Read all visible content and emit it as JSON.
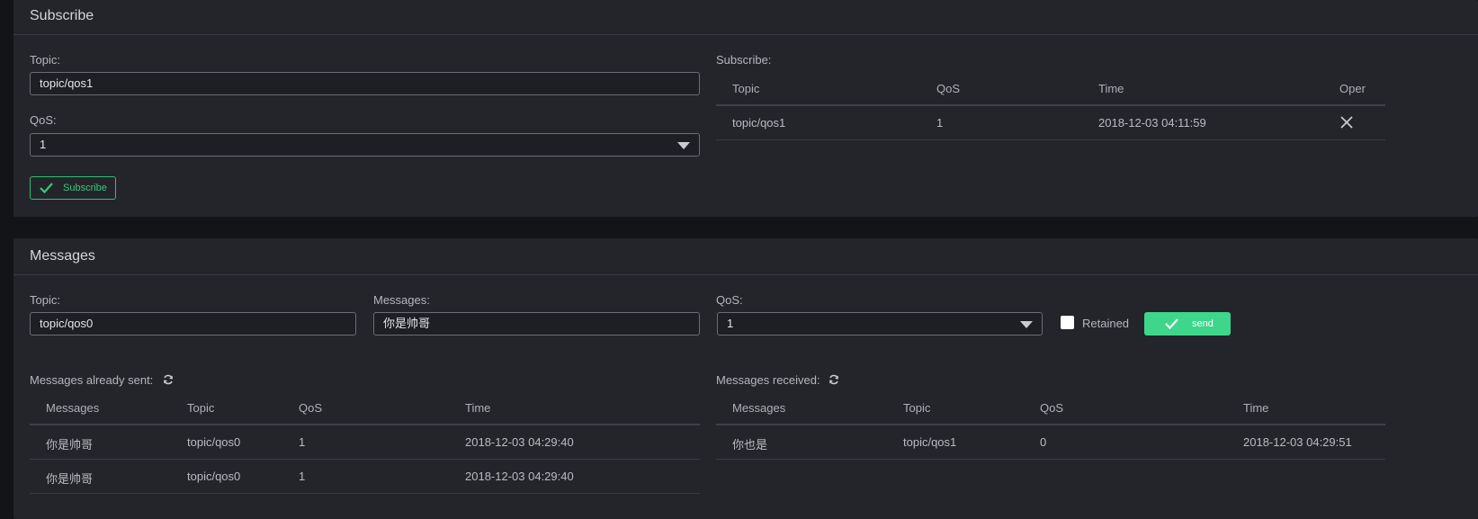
{
  "subscribe_panel": {
    "title": "Subscribe",
    "topic_label": "Topic:",
    "topic_value": "topic/qos1",
    "qos_label": "QoS:",
    "qos_value": "1",
    "subscribe_button": "Subscribe",
    "list_label": "Subscribe:",
    "table": {
      "headers": [
        "Topic",
        "QoS",
        "Time",
        "Oper"
      ],
      "rows": [
        {
          "topic": "topic/qos1",
          "qos": "1",
          "time": "2018-12-03 04:11:59"
        }
      ]
    }
  },
  "messages_panel": {
    "title": "Messages",
    "topic_label": "Topic:",
    "topic_value": "topic/qos0",
    "messages_label": "Messages:",
    "messages_value": "你是帅哥",
    "qos_label": "QoS:",
    "qos_value": "1",
    "retained_label": "Retained",
    "send_button": "send",
    "sent": {
      "label": "Messages already sent:",
      "headers": [
        "Messages",
        "Topic",
        "QoS",
        "Time"
      ],
      "rows": [
        {
          "message": "你是帅哥",
          "topic": "topic/qos0",
          "qos": "1",
          "time": "2018-12-03 04:29:40"
        },
        {
          "message": "你是帅哥",
          "topic": "topic/qos0",
          "qos": "1",
          "time": "2018-12-03 04:29:40"
        }
      ]
    },
    "received": {
      "label": "Messages received:",
      "headers": [
        "Messages",
        "Topic",
        "QoS",
        "Time"
      ],
      "rows": [
        {
          "message": "你也是",
          "topic": "topic/qos1",
          "qos": "0",
          "time": "2018-12-03 04:29:51"
        }
      ]
    }
  },
  "colors": {
    "accent_green": "#3dd68a",
    "panel_bg": "#24252b",
    "page_bg": "#131417"
  },
  "icons": {
    "subscribe_button_icon": "check-icon",
    "send_button_icon": "check-icon",
    "oper_icon": "close-icon",
    "sent_refresh": "refresh-icon",
    "received_refresh": "refresh-icon",
    "select_caret": "caret-down-icon"
  }
}
